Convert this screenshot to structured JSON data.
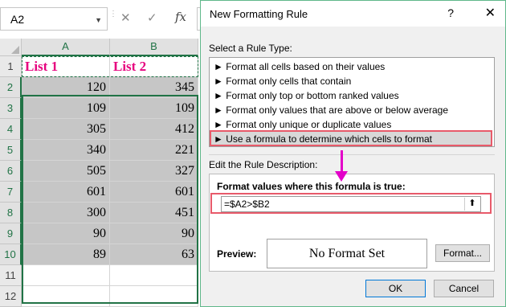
{
  "formula_bar": {
    "name_box": "A2",
    "fx_label": "fx",
    "cancel_icon": "✕",
    "enter_icon": "✓"
  },
  "sheet": {
    "columns": [
      "A",
      "B"
    ],
    "rows": [
      "1",
      "2",
      "3",
      "4",
      "5",
      "6",
      "7",
      "8",
      "9",
      "10",
      "11",
      "12"
    ],
    "header": [
      "List 1",
      "List 2"
    ],
    "data": [
      [
        "120",
        "345"
      ],
      [
        "109",
        "109"
      ],
      [
        "305",
        "412"
      ],
      [
        "340",
        "221"
      ],
      [
        "505",
        "327"
      ],
      [
        "601",
        "601"
      ],
      [
        "300",
        "451"
      ],
      [
        "90",
        "90"
      ],
      [
        "89",
        "63"
      ]
    ]
  },
  "dialog": {
    "title": "New Formatting Rule",
    "help": "?",
    "close": "✕",
    "select_rule_type_label": "Select a Rule Type:",
    "rule_types": [
      "► Format all cells based on their values",
      "► Format only cells that contain",
      "► Format only top or bottom ranked values",
      "► Format only values that are above or below average",
      "► Format only unique or duplicate values",
      "► Use a formula to determine which cells to format"
    ],
    "selected_rule_index": 5,
    "edit_desc_label": "Edit the Rule Description:",
    "formula_label": "Format values where this formula is true:",
    "formula_value": "=$A2>$B2",
    "preview_label": "Preview:",
    "preview_text": "No Format Set",
    "format_button": "Format...",
    "ok_button": "OK",
    "cancel_button": "Cancel"
  },
  "colors": {
    "accent_green": "#217346",
    "header_pink": "#e6007e",
    "highlight_red": "#e85a6a",
    "arrow_magenta": "#e300c9"
  }
}
